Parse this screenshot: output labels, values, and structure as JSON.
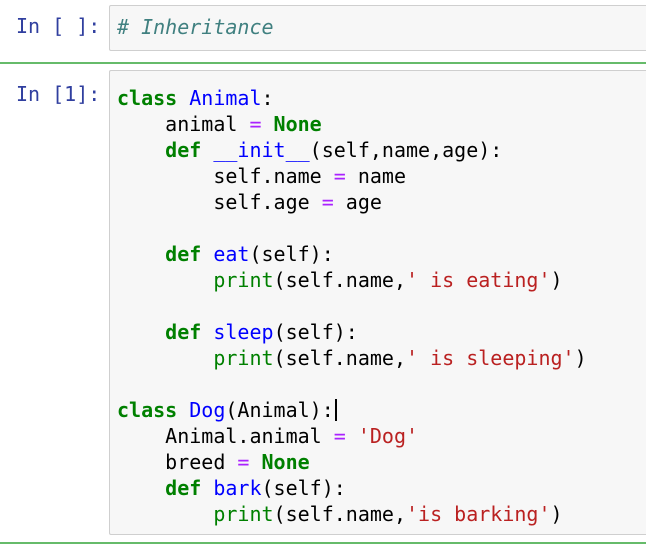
{
  "cells": [
    {
      "prompt": "In [ ]:",
      "lines": [
        [
          {
            "t": "# Inheritance",
            "c": "comment"
          }
        ]
      ]
    },
    {
      "prompt": "In [1]:",
      "lines": [
        [
          {
            "t": "class",
            "c": "keyword"
          },
          {
            "t": " ",
            "c": "name"
          },
          {
            "t": "Animal",
            "c": "def"
          },
          {
            "t": ":",
            "c": "punct"
          }
        ],
        [
          {
            "t": "    animal ",
            "c": "name"
          },
          {
            "t": "=",
            "c": "op"
          },
          {
            "t": " ",
            "c": "name"
          },
          {
            "t": "None",
            "c": "const"
          }
        ],
        [
          {
            "t": "    ",
            "c": "name"
          },
          {
            "t": "def",
            "c": "keyword"
          },
          {
            "t": " ",
            "c": "name"
          },
          {
            "t": "__init__",
            "c": "def"
          },
          {
            "t": "(self,name,age):",
            "c": "punct"
          }
        ],
        [
          {
            "t": "        self.name ",
            "c": "name"
          },
          {
            "t": "=",
            "c": "op"
          },
          {
            "t": " name",
            "c": "name"
          }
        ],
        [
          {
            "t": "        self.age ",
            "c": "name"
          },
          {
            "t": "=",
            "c": "op"
          },
          {
            "t": " age",
            "c": "name"
          }
        ],
        [],
        [
          {
            "t": "    ",
            "c": "name"
          },
          {
            "t": "def",
            "c": "keyword"
          },
          {
            "t": " ",
            "c": "name"
          },
          {
            "t": "eat",
            "c": "def"
          },
          {
            "t": "(self):",
            "c": "punct"
          }
        ],
        [
          {
            "t": "        ",
            "c": "name"
          },
          {
            "t": "print",
            "c": "builtin"
          },
          {
            "t": "(self.name,",
            "c": "punct"
          },
          {
            "t": "' is eating'",
            "c": "str"
          },
          {
            "t": ")",
            "c": "punct"
          }
        ],
        [],
        [
          {
            "t": "    ",
            "c": "name"
          },
          {
            "t": "def",
            "c": "keyword"
          },
          {
            "t": " ",
            "c": "name"
          },
          {
            "t": "sleep",
            "c": "def"
          },
          {
            "t": "(self):",
            "c": "punct"
          }
        ],
        [
          {
            "t": "        ",
            "c": "name"
          },
          {
            "t": "print",
            "c": "builtin"
          },
          {
            "t": "(self.name,",
            "c": "punct"
          },
          {
            "t": "' is sleeping'",
            "c": "str"
          },
          {
            "t": ")",
            "c": "punct"
          }
        ],
        [],
        [
          {
            "t": "class",
            "c": "keyword"
          },
          {
            "t": " ",
            "c": "name"
          },
          {
            "t": "Dog",
            "c": "def"
          },
          {
            "t": "(Animal):",
            "c": "punct"
          },
          {
            "t": "",
            "c": "cursor"
          }
        ],
        [
          {
            "t": "    Animal.animal ",
            "c": "name"
          },
          {
            "t": "=",
            "c": "op"
          },
          {
            "t": " ",
            "c": "name"
          },
          {
            "t": "'Dog'",
            "c": "str"
          }
        ],
        [
          {
            "t": "    breed ",
            "c": "name"
          },
          {
            "t": "=",
            "c": "op"
          },
          {
            "t": " ",
            "c": "name"
          },
          {
            "t": "None",
            "c": "const"
          }
        ],
        [
          {
            "t": "    ",
            "c": "name"
          },
          {
            "t": "def",
            "c": "keyword"
          },
          {
            "t": " ",
            "c": "name"
          },
          {
            "t": "bark",
            "c": "def"
          },
          {
            "t": "(self):",
            "c": "punct"
          }
        ],
        [
          {
            "t": "        ",
            "c": "name"
          },
          {
            "t": "print",
            "c": "builtin"
          },
          {
            "t": "(self.name,",
            "c": "punct"
          },
          {
            "t": "'is barking'",
            "c": "str"
          },
          {
            "t": ")",
            "c": "punct"
          }
        ]
      ]
    }
  ],
  "colors": {
    "prompt": "#303f9f",
    "keyword": "#008000",
    "def_name": "#0000ff",
    "operator": "#aa22ff",
    "string": "#ba2121",
    "comment": "#408080",
    "selected_cell_border": "#66bb6a",
    "input_background": "#f7f7f7"
  }
}
